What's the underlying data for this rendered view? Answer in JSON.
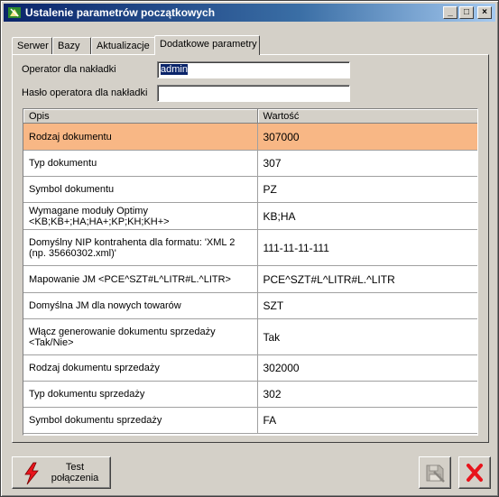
{
  "window": {
    "title": "Ustalenie parametrów początkowych",
    "controls": {
      "minimize": "_",
      "maximize": "□",
      "close": "×"
    }
  },
  "tabs": [
    {
      "label": "Serwer",
      "active": false
    },
    {
      "label": "Bazy",
      "active": false
    },
    {
      "label": "Aktualizacje",
      "active": false
    },
    {
      "label": "Dodatkowe parametry",
      "active": true
    }
  ],
  "form": {
    "operator_label": "Operator dla nakładki",
    "operator_value": "admin",
    "password_label": "Hasło operatora dla nakładki",
    "password_value": ""
  },
  "grid": {
    "headers": [
      "Opis",
      "Wartość"
    ],
    "rows": [
      {
        "opis": "Rodzaj dokumentu",
        "wartosc": "307000",
        "selected": true
      },
      {
        "opis": "Typ dokumentu",
        "wartosc": "307"
      },
      {
        "opis": "Symbol dokumentu",
        "wartosc": "PZ"
      },
      {
        "opis": "Wymagane moduły Optimy <KB;KB+;HA;HA+;KP;KH;KH+>",
        "wartosc": "KB;HA"
      },
      {
        "opis": "Domyślny NIP kontrahenta dla formatu: 'XML 2 (np. 35660302.xml)'",
        "wartosc": "111-11-11-111"
      },
      {
        "opis": "Mapowanie JM <PCE^SZT#L^LITR#L.^LITR>",
        "wartosc": "PCE^SZT#L^LITR#L.^LITR"
      },
      {
        "opis": "Domyślna JM dla nowych towarów",
        "wartosc": "SZT"
      },
      {
        "opis": "Włącz generowanie dokumentu sprzedaży <Tak/Nie>",
        "wartosc": "Tak"
      },
      {
        "opis": "Rodzaj dokumentu sprzedaży",
        "wartosc": "302000"
      },
      {
        "opis": "Typ dokumentu sprzedaży",
        "wartosc": "302"
      },
      {
        "opis": "Symbol dokumentu sprzedaży",
        "wartosc": "FA"
      }
    ]
  },
  "buttons": {
    "test_line1": "Test",
    "test_line2": "połączenia"
  },
  "colors": {
    "selected_row": "#f8b785",
    "title_gradient_start": "#0a246a",
    "close_icon": "#e8141c",
    "lightning_icon": "#e8141c"
  }
}
